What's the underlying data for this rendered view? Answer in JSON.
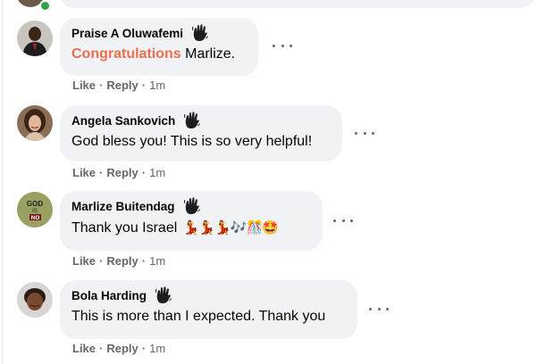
{
  "comments": [
    {
      "author": "Praise A Oluwafemi",
      "text_highlight": "Congratulations",
      "text": " Marlize.",
      "like": "Like",
      "reply": "Reply",
      "time": "1m"
    },
    {
      "author": "Angela Sankovich",
      "text": "God bless you! This is so very helpful!",
      "like": "Like",
      "reply": "Reply",
      "time": "1m"
    },
    {
      "author": "Marlize Buitendag",
      "text": "Thank you Israel",
      "emojis": "💃💃💃🎶🎊🤩",
      "avatar_text": "GOD IS NO",
      "like": "Like",
      "reply": "Reply",
      "time": "1m"
    },
    {
      "author": "Bola Harding",
      "text": "This is more than I expected. Thank you",
      "like": "Like",
      "reply": "Reply",
      "time": "1m"
    }
  ],
  "colors": {
    "bubble": "#f0f2f5",
    "highlight": "#ee6d4e",
    "meta": "#65676b",
    "text": "#050505"
  },
  "icons": {
    "badge": "waving-hand-badge-icon",
    "more": "more-options-icon"
  }
}
